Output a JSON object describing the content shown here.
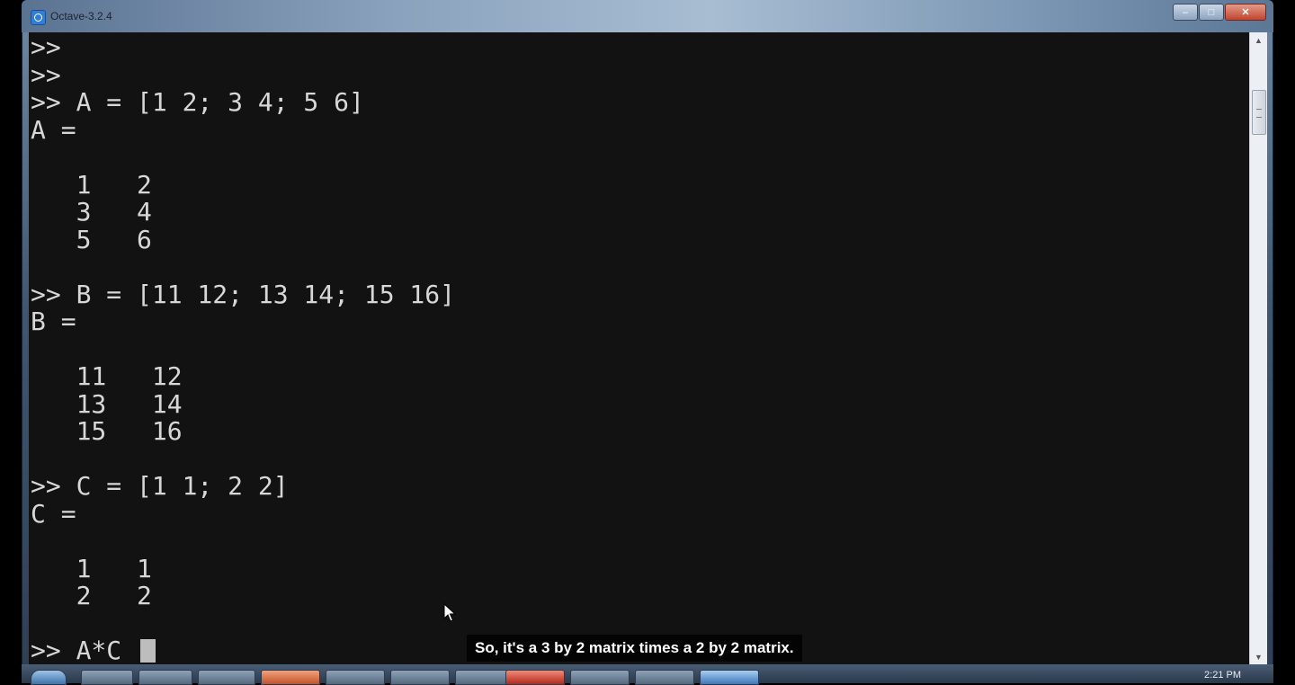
{
  "window": {
    "title": "Octave-3.2.4",
    "buttons": {
      "minimize": "–",
      "maximize": "□",
      "close": "✕"
    }
  },
  "console": {
    "lines": [
      ">>",
      ">>",
      ">> A = [1 2; 3 4; 5 6]",
      "A =",
      "",
      "   1   2",
      "   3   4",
      "   5   6",
      "",
      ">> B = [11 12; 13 14; 15 16]",
      "B =",
      "",
      "   11   12",
      "   13   14",
      "   15   16",
      "",
      ">> C = [1 1; 2 2]",
      "C =",
      "",
      "   1   1",
      "   2   2",
      ""
    ],
    "current_input": ">> A*C "
  },
  "scrollbar": {
    "up_arrow": "▲",
    "down_arrow": "▼"
  },
  "taskbar": {
    "clock": "2:21 PM"
  },
  "caption": {
    "text": "So, it's a 3 by 2 matrix times a 2 by 2 matrix."
  },
  "colors": {
    "console_bg": "#121212",
    "console_text": "#d7d7d7",
    "title_bar": "#8aa2bd",
    "close_button": "#c0452e"
  }
}
